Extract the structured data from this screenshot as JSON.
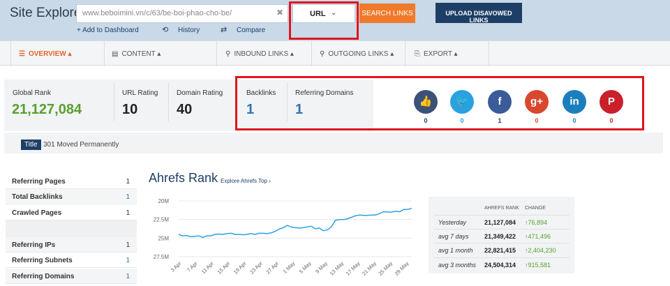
{
  "header": {
    "app_title": "Site Explorer:",
    "url_value": "www.beboimini.vn/c/63/be-boi-phao-cho-be/",
    "mode_selected": "URL",
    "search_label": "SEARCH LINKS",
    "upload_label": "UPLOAD DISAVOWED LINKS",
    "sublinks": {
      "add": "+ Add to Dashboard",
      "history": "History",
      "compare": "Compare"
    },
    "highlight_color": "#e0141e"
  },
  "nav": {
    "overview": "OVERVIEW",
    "content": "CONTENT",
    "inbound": "INBOUND LINKS",
    "outgoing": "OUTGOING LINKS",
    "export": "EXPORT"
  },
  "metrics": {
    "global_rank_label": "Global Rank",
    "global_rank": "21,127,084",
    "url_rating_label": "URL Rating",
    "url_rating": "10",
    "domain_rating_label": "Domain Rating",
    "domain_rating": "40",
    "backlinks_label": "Backlinks",
    "backlinks": "1",
    "ref_domains_label": "Referring Domains",
    "ref_domains": "1"
  },
  "social": [
    {
      "name": "facebook-like",
      "glyph": "👍",
      "count": "0",
      "color": "#3b5178",
      "count_color": "#1d3f66"
    },
    {
      "name": "twitter",
      "glyph": "🐦",
      "count": "0",
      "color": "#2aa2e0",
      "count_color": "#2aa2e0"
    },
    {
      "name": "facebook",
      "glyph": "f",
      "count": "1",
      "color": "#3b5b99",
      "count_color": "#1d3f66"
    },
    {
      "name": "google-plus",
      "glyph": "g+",
      "count": "0",
      "color": "#d9472f",
      "count_color": "#d9472f"
    },
    {
      "name": "linkedin",
      "glyph": "in",
      "count": "0",
      "color": "#1b7fbd",
      "count_color": "#1b7fbd"
    },
    {
      "name": "pinterest",
      "glyph": "P",
      "count": "0",
      "color": "#c9202a",
      "count_color": "#c9202a"
    }
  ],
  "title_row": {
    "badge": "Title",
    "text": "301 Moved Permanently"
  },
  "stats": [
    {
      "label": "Referring Pages",
      "value": "1"
    },
    {
      "label": "Total Backlinks",
      "value": "1"
    },
    {
      "label": "Crawled Pages",
      "value": "1"
    },
    {
      "label": "Referring IPs",
      "value": "1"
    },
    {
      "label": "Referring Subnets",
      "value": "1"
    },
    {
      "label": "Referring Domains",
      "value": "1"
    }
  ],
  "chart_title": "Ahrefs Rank",
  "chart_link": "Explore Ahrefs Top ›",
  "chart_data": {
    "type": "line",
    "title": "Ahrefs Rank",
    "x_tick_labels": [
      "3 Apr",
      "7 Apr",
      "11 Apr",
      "15 Apr",
      "19 Apr",
      "23 Apr",
      "27 Apr",
      "1 May",
      "5 May",
      "9 May",
      "13 May",
      "17 May",
      "21 May",
      "25 May",
      "29 May"
    ],
    "y_tick_labels": [
      "20M",
      "22.5M",
      "25M",
      "27.5M"
    ],
    "ylim": [
      20000000,
      27500000
    ],
    "y_inverted": true,
    "line_color": "#2aa2e0",
    "series": [
      {
        "values": [
          24500000,
          24700000,
          24650000,
          24800000,
          24750000,
          24700000,
          24900000,
          24700000,
          24700000,
          24500000,
          24450000,
          24500000,
          24400000,
          24350000,
          24500000,
          24500000,
          24550000,
          24500000,
          24400000,
          24500000,
          24350000,
          24350000,
          24400000,
          24300000,
          24100000,
          23800000,
          23600000,
          23300000,
          23500000,
          23600000,
          23650000,
          23600000,
          23500000,
          23400000,
          23750000,
          23650000,
          24000000,
          23900000,
          23500000,
          22600000,
          22500000,
          22500000,
          22400000,
          22200000,
          22000000,
          21900000,
          21950000,
          21950000,
          21900000,
          21900000,
          21700000,
          21450000,
          21500000,
          21500000,
          21400000,
          21450000,
          21150000,
          21150000,
          21000000
        ]
      }
    ]
  },
  "rank_table": {
    "col_rank": "AHREFS RANK",
    "col_change": "CHANGE",
    "rows": [
      {
        "label": "Yesterday",
        "rank": "21,127,084",
        "change": "↑76,894"
      },
      {
        "label": "avg 7 days",
        "rank": "21,349,422",
        "change": "↑471,496"
      },
      {
        "label": "avg 1 month",
        "rank": "22,821,415",
        "change": "↑2,404,230"
      },
      {
        "label": "avg 3 months",
        "rank": "24,504,314",
        "change": "↑915,581"
      }
    ]
  }
}
